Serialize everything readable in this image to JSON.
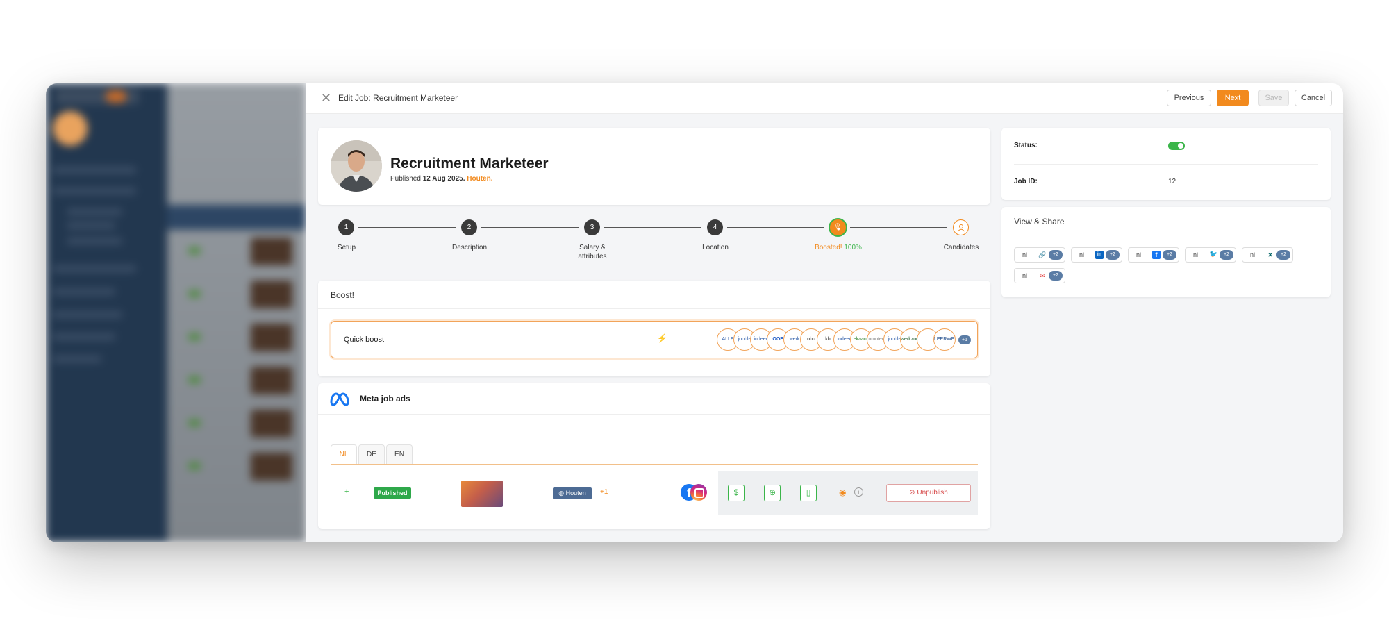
{
  "modal": {
    "title": "Edit Job: Recruitment Marketeer",
    "buttons": {
      "previous": "Previous",
      "next": "Next",
      "save": "Save",
      "cancel": "Cancel"
    }
  },
  "job": {
    "title": "Recruitment Marketeer",
    "published_prefix": "Published",
    "published_date": "12 Aug 2025.",
    "location": "Houten."
  },
  "stepper": {
    "steps": [
      {
        "number": "1",
        "label": "Setup"
      },
      {
        "number": "2",
        "label": "Description"
      },
      {
        "number": "3",
        "label": "Salary & attributes"
      },
      {
        "number": "4",
        "label": "Location"
      },
      {
        "number": "",
        "label": "Boosted!",
        "extra": "100%"
      },
      {
        "number": "",
        "label": "Candidates"
      }
    ],
    "active_step": 5
  },
  "boost": {
    "heading": "Boost!",
    "quick_boost_label": "Quick boost",
    "channel_logos": [
      "ALLE",
      "jooble",
      "indeed",
      "OOF",
      "werk",
      "nbu",
      "kb",
      "indeed",
      "ekaans",
      "nmotend",
      "jooble",
      "werkzoeken",
      "",
      "LEERWERK"
    ],
    "more_count": "+1"
  },
  "meta_ads": {
    "title": "Meta job ads",
    "tabs": [
      "NL",
      "DE",
      "EN"
    ],
    "active_tab": "NL",
    "row": {
      "add_icon": "+",
      "status": "Published",
      "location": "Houten",
      "location_more": "+1",
      "unpublish_label": "Unpublish"
    }
  },
  "status_panel": {
    "status_label": "Status:",
    "status_on": true,
    "job_id_label": "Job ID:",
    "job_id_value": "12"
  },
  "share": {
    "title": "View & Share",
    "groups": [
      {
        "lang": "nl",
        "icon": "link-icon",
        "badge": "+2"
      },
      {
        "lang": "nl",
        "icon": "linkedin-icon",
        "badge": "+2"
      },
      {
        "lang": "nl",
        "icon": "facebook-icon",
        "badge": "+2"
      },
      {
        "lang": "nl",
        "icon": "twitter-icon",
        "badge": "+2"
      },
      {
        "lang": "nl",
        "icon": "xing-icon",
        "badge": "+2"
      },
      {
        "lang": "nl",
        "icon": "mail-icon",
        "badge": "+2"
      }
    ]
  },
  "colors": {
    "accent": "#f28a1e",
    "success": "#3bb54a",
    "badge": "#5a7ca5",
    "sidebar": "#22374f"
  }
}
